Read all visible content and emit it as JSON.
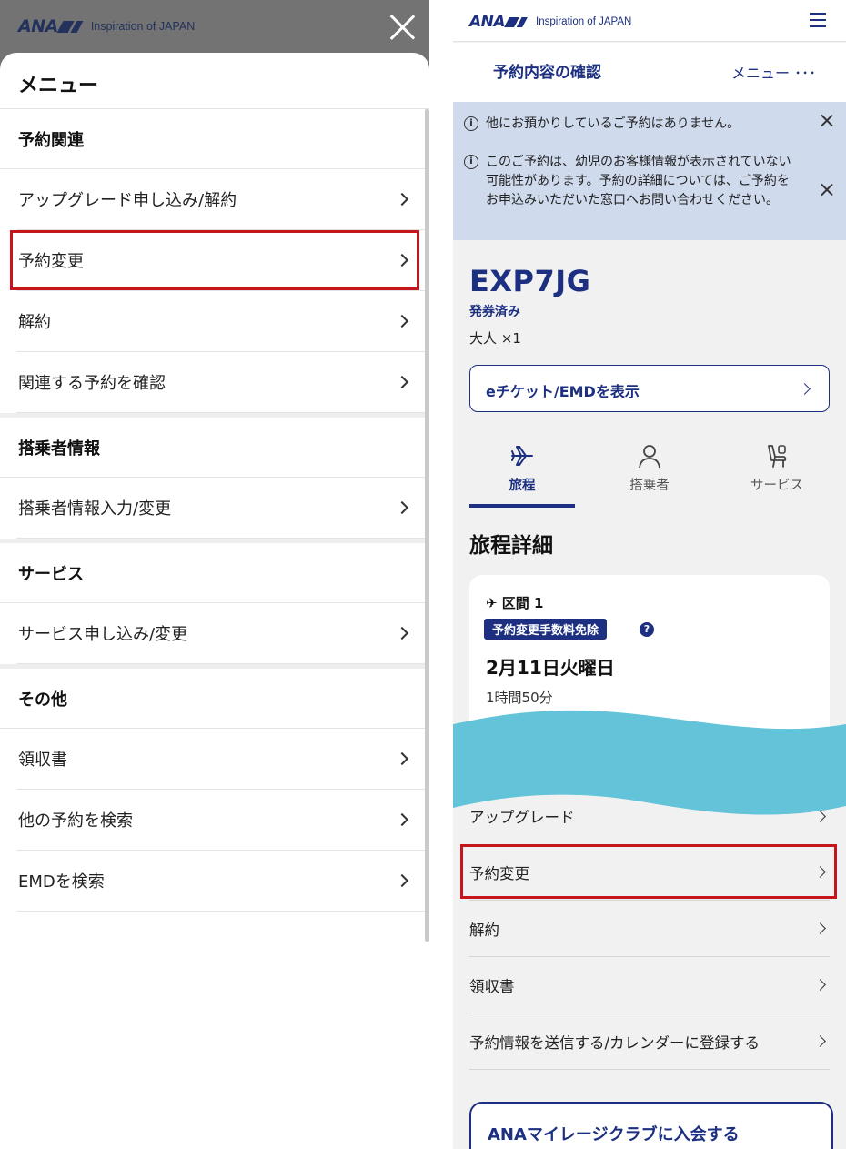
{
  "left": {
    "logo_text": "ANA",
    "logo_tagline": "Inspiration of JAPAN",
    "sheet_title": "メニュー",
    "sections": [
      {
        "heading": "予約関連",
        "items": [
          {
            "label": "アップグレード申し込み/解約"
          },
          {
            "label": "予約変更",
            "highlighted": true
          },
          {
            "label": "解約"
          },
          {
            "label": "関連する予約を確認"
          }
        ]
      },
      {
        "heading": "搭乗者情報",
        "items": [
          {
            "label": "搭乗者情報入力/変更"
          }
        ]
      },
      {
        "heading": "サービス",
        "items": [
          {
            "label": "サービス申し込み/変更"
          }
        ]
      },
      {
        "heading": "その他",
        "items": [
          {
            "label": "領収書"
          },
          {
            "label": "他の予約を検索"
          },
          {
            "label": "EMDを検索"
          }
        ]
      }
    ]
  },
  "right": {
    "logo_text": "ANA",
    "logo_tagline": "Inspiration of JAPAN",
    "page_title": "予約内容の確認",
    "menu_label": "メニュー ･･･",
    "notices": [
      "他にお預かりしているご予約はありません。",
      "このご予約は、幼児のお客様情報が表示されていない可能性があります。予約の詳細については、ご予約をお申込みいただいた窓口へお問い合わせください。"
    ],
    "pnr": "EXP7JG",
    "ticket_status": "発券済み",
    "passengers": "大人 ×1",
    "eticket_button": "eチケット/EMDを表示",
    "tabs": [
      {
        "label": "旅程",
        "icon": "airplane-icon",
        "active": true
      },
      {
        "label": "搭乗者",
        "icon": "person-icon",
        "active": false
      },
      {
        "label": "サービス",
        "icon": "seat-icon",
        "active": false
      }
    ],
    "section_title": "旅程詳細",
    "segment": {
      "label": "区間 1",
      "badge": "予約変更手数料免除",
      "help": "?",
      "date": "2月11日火曜日",
      "duration": "1時間50分"
    },
    "actions": [
      {
        "label": "アップグレード"
      },
      {
        "label": "予約変更",
        "highlighted": true
      },
      {
        "label": "解約"
      },
      {
        "label": "領収書"
      },
      {
        "label": "予約情報を送信する/カレンダーに登録する"
      }
    ],
    "mileage_button": "ANAマイレージクラブに入会する"
  },
  "colors": {
    "ana_blue": "#1c2f80",
    "highlight_red": "#c4161c",
    "notice_bg": "#cfdaed",
    "wave": "#62c3d9"
  }
}
